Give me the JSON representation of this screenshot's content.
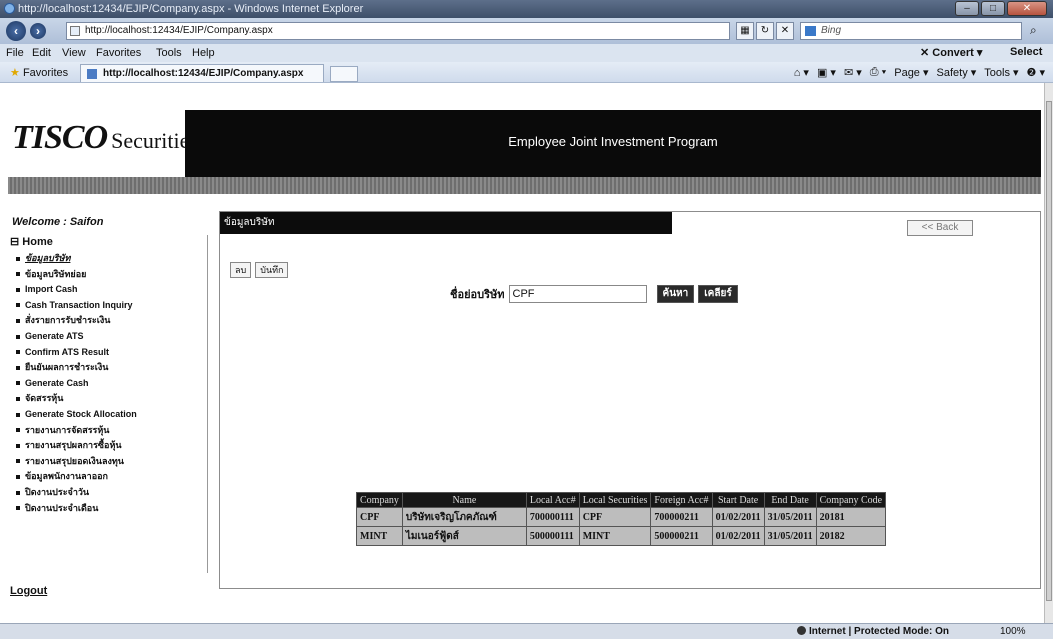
{
  "browser": {
    "window_title": "http://localhost:12434/EJIP/Company.aspx - Windows Internet Explorer",
    "address": "http://localhost:12434/EJIP/Company.aspx",
    "address_host": "localhost",
    "search_placeholder": "Bing",
    "menu": [
      "File",
      "Edit",
      "View",
      "Favorites",
      "Tools",
      "Help"
    ],
    "menu_right": [
      "Convert",
      "Select"
    ],
    "favorites_label": "Favorites",
    "tab_title": "http://localhost:12434/EJIP/Company.aspx",
    "command_bar": [
      "Page",
      "Safety",
      "Tools"
    ],
    "status_zone": "Internet | Protected Mode: On",
    "zoom": "100%"
  },
  "page": {
    "logo_main": "TISCO",
    "logo_sub": "Securities",
    "banner_title": "Employee Joint Investment Program",
    "welcome": "Welcome : Saifon",
    "logout": "Logout"
  },
  "sidebar": {
    "home": "Home",
    "items": [
      "ข้อมูลบริษัท",
      "ข้อมูลบริษัทย่อย",
      "Import Cash",
      "Cash Transaction Inquiry",
      "สั่งรายการรับชำระเงิน",
      "Generate ATS",
      "Confirm ATS Result",
      "ยืนยันผลการชำระเงิน",
      "Generate Cash",
      "จัดสรรหุ้น",
      "Generate Stock Allocation",
      "รายงานการจัดสรรหุ้น",
      "รายงานสรุปผลการซื้อหุ้น",
      "รายงานสรุปยอดเงินลงทุน",
      "ข้อมูลพนักงานลาออก",
      "ปิดงานประจำวัน",
      "ปิดงานประจำเดือน"
    ]
  },
  "panel": {
    "heading": "ข้อมูลบริษัท",
    "back_label": "<< Back",
    "delete_label": "ลบ",
    "save_label": "บันทึก",
    "search_label": "ชื่อย่อบริษัท",
    "search_value": "CPF",
    "search_button": "ค้นหา",
    "clear_button": "เคลียร์"
  },
  "table": {
    "columns": [
      "Company",
      "Name",
      "Local Acc#",
      "Local Securities",
      "Foreign Acc#",
      "Start Date",
      "End Date",
      "Company Code"
    ],
    "rows": [
      [
        "CPF",
        "บริษัทเจริญโภคภัณฑ์",
        "700000111",
        "CPF",
        "700000211",
        "01/02/2011",
        "31/05/2011",
        "20181"
      ],
      [
        "MINT",
        "ไมเนอร์ฟู้ดส์",
        "500000111",
        "MINT",
        "500000211",
        "01/02/2011",
        "31/05/2011",
        "20182"
      ]
    ]
  }
}
